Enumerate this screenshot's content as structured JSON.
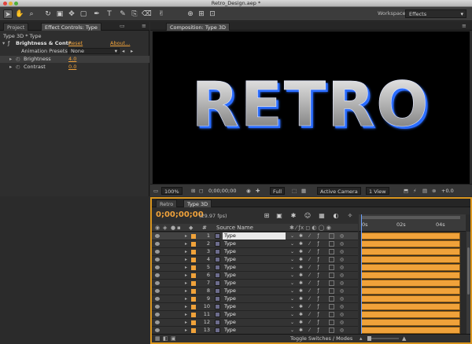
{
  "window": {
    "title": "Retro_Design.aep *"
  },
  "toolbar": {
    "tools": [
      {
        "icon": "selection-tool-icon",
        "glyph": "➤"
      },
      {
        "icon": "hand-tool-icon",
        "glyph": "✋"
      },
      {
        "icon": "zoom-tool-icon",
        "glyph": "🔍"
      },
      {
        "icon": "rotate-tool-icon",
        "glyph": "↻"
      },
      {
        "icon": "camera-tool-icon",
        "glyph": "▣"
      },
      {
        "icon": "pan-behind-tool-icon",
        "glyph": "✥"
      },
      {
        "icon": "mask-tool-icon",
        "glyph": "▢"
      },
      {
        "icon": "pen-tool-icon",
        "glyph": "✒"
      },
      {
        "icon": "type-tool-icon",
        "glyph": "T"
      },
      {
        "icon": "brush-tool-icon",
        "glyph": "✎"
      },
      {
        "icon": "clone-tool-icon",
        "glyph": "⎘"
      },
      {
        "icon": "eraser-tool-icon",
        "glyph": "⌫"
      },
      {
        "icon": "puppet-tool-icon",
        "glyph": "✌"
      }
    ],
    "workspace_label": "Workspace:",
    "workspace_value": "Effects"
  },
  "left_panel": {
    "tabs": [
      "Project",
      "Effect Controls: Type"
    ],
    "breadcrumb": "Type 3D * Type",
    "effect": {
      "name": "Brightness & Contr",
      "reset": "Reset",
      "about": "About..."
    },
    "animation_presets_label": "Animation Presets:",
    "animation_presets_value": "None",
    "params": [
      {
        "name": "Brightness",
        "value": "4.0"
      },
      {
        "name": "Contrast",
        "value": "0.0"
      }
    ]
  },
  "comp_panel": {
    "tab": "Composition: Type 3D",
    "artwork_text": "RETRO",
    "zoom": "100%",
    "timecode": "0;00;00;00",
    "resolution": "Full",
    "camera": "Active Camera",
    "views": "1 View",
    "exposure": "+0.0"
  },
  "timeline": {
    "tabs": [
      "Retro",
      "Type 3D"
    ],
    "timecode": "0;00;00;00",
    "fps": "(29.97 fps)",
    "source_name_header": "Source Name",
    "number_header": "#",
    "ruler_marks": [
      "0s",
      "02s",
      "04s"
    ],
    "layers": [
      {
        "num": "1",
        "name": "Type"
      },
      {
        "num": "2",
        "name": "Type"
      },
      {
        "num": "3",
        "name": "Type"
      },
      {
        "num": "4",
        "name": "Type"
      },
      {
        "num": "5",
        "name": "Type"
      },
      {
        "num": "6",
        "name": "Type"
      },
      {
        "num": "7",
        "name": "Type"
      },
      {
        "num": "8",
        "name": "Type"
      },
      {
        "num": "9",
        "name": "Type"
      },
      {
        "num": "10",
        "name": "Type"
      },
      {
        "num": "11",
        "name": "Type"
      },
      {
        "num": "12",
        "name": "Type"
      },
      {
        "num": "13",
        "name": "Type"
      }
    ],
    "toggle_label": "Toggle Switches / Modes"
  },
  "colors": {
    "accent": "#f0a23a",
    "panel": "#2e2e2e",
    "highlight_border": "#d9951e"
  }
}
